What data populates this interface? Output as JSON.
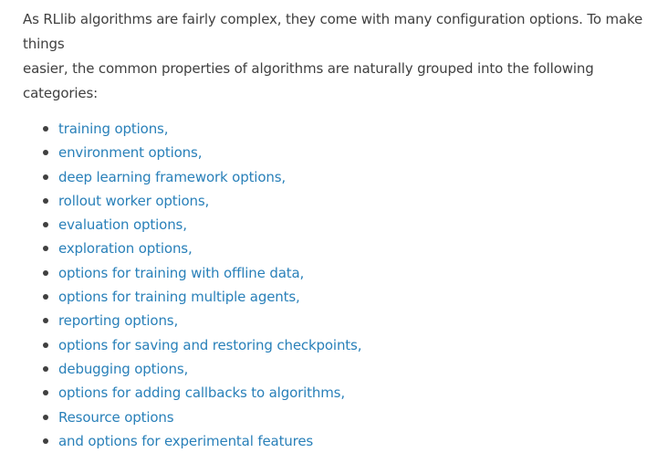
{
  "intro": {
    "line1": "As RLlib algorithms are fairly complex, they come with many configuration options. To make things",
    "line2": "easier, the common properties of algorithms are naturally grouped into the following categories:"
  },
  "options": [
    {
      "label": "training options,"
    },
    {
      "label": "environment options,"
    },
    {
      "label": "deep learning framework options,"
    },
    {
      "label": "rollout worker options,"
    },
    {
      "label": "evaluation options,"
    },
    {
      "label": "exploration options,"
    },
    {
      "label": "options for training with offline data,"
    },
    {
      "label": "options for training multiple agents,"
    },
    {
      "label": "reporting options,"
    },
    {
      "label": "options for saving and restoring checkpoints,"
    },
    {
      "label": "debugging options,"
    },
    {
      "label": "options for adding callbacks to algorithms,"
    },
    {
      "label": "Resource options"
    },
    {
      "label": "and options for experimental features"
    }
  ],
  "colors": {
    "text": "#404040",
    "link": "#2980b9",
    "background": "#ffffff"
  }
}
